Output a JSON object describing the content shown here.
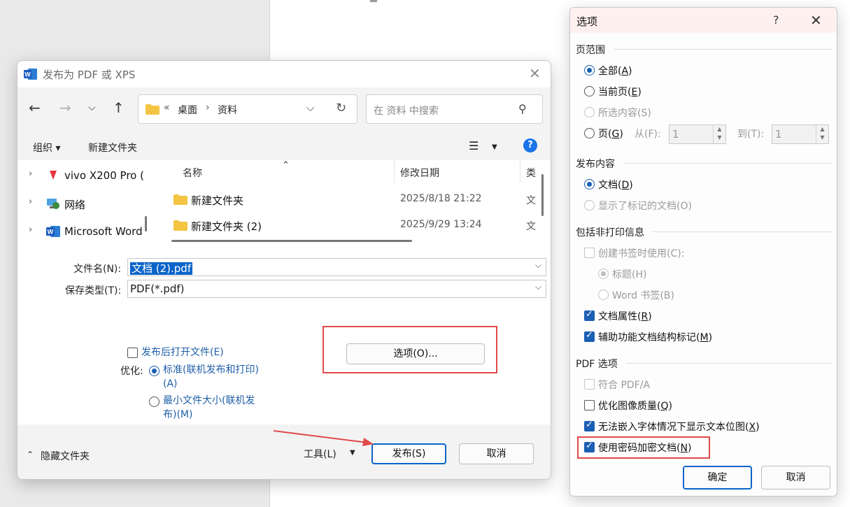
{
  "publish_dialog": {
    "title": "发布为 PDF 或 XPS",
    "address": {
      "chevrons": "«",
      "crumbs": [
        "桌面",
        "资料"
      ]
    },
    "search_placeholder": "在 资料 中搜索",
    "toolbar": {
      "organize": "组织 ▾",
      "new_folder": "新建文件夹",
      "help": "?"
    },
    "tree": [
      {
        "label": "vivo X200 Pro (",
        "icon": "phone-icon"
      },
      {
        "label": "网络",
        "icon": "network-icon"
      },
      {
        "label": "Microsoft Word",
        "icon": "word-icon"
      }
    ],
    "columns": {
      "name": "名称",
      "modified": "修改日期",
      "type": "类"
    },
    "files": [
      {
        "name": "新建文件夹",
        "date": "2025/8/18 21:22",
        "type": "文"
      },
      {
        "name": "新建文件夹 (2)",
        "date": "2025/9/29 13:24",
        "type": "文"
      }
    ],
    "filename_label": "文件名(N):",
    "filename_value": "文档 (2).pdf",
    "filetype_label": "保存类型(T):",
    "filetype_value": "PDF(*.pdf)",
    "open_after": "发布后打开文件(E)",
    "optimize_label": "优化:",
    "opt_standard_1": "标准(联机发布和打印)",
    "opt_standard_2": "(A)",
    "opt_min_1": "最小文件大小(联机发",
    "opt_min_2": "布)(M)",
    "options_button": "选项(O)...",
    "hide_folders": "隐藏文件夹",
    "tools": "工具(L)",
    "publish": "发布(S)",
    "cancel": "取消"
  },
  "options_dialog": {
    "title": "选项",
    "help": "?",
    "range_section": "页范围",
    "all": "全部(",
    "all_key": "A",
    "current": "当前页(",
    "current_key": "E",
    "selection": "所选内容(S)",
    "pages": "页(",
    "pages_key": "G",
    "from_label": "从(F):",
    "from_value": "1",
    "to_label": "到(T):",
    "to_value": "1",
    "content_section": "发布内容",
    "document": "文档(",
    "document_key": "D",
    "markup": "显示了标记的文档(O)",
    "nonprint_section": "包括非打印信息",
    "bookmarks": "创建书签时使用(C):",
    "headings": "标题(H)",
    "word_bookmarks": "Word 书签(B)",
    "doc_props": "文档属性(",
    "doc_props_key": "R",
    "structure_tags": "辅助功能文档结构标记(",
    "structure_tags_key": "M",
    "pdf_section": "PDF 选项",
    "pdfa": "符合 PDF/A",
    "image_quality": "优化图像质量(",
    "image_quality_key": "Q",
    "bitmap_text": "无法嵌入字体情况下显示文本位图(",
    "bitmap_text_key": "X",
    "encrypt": "使用密码加密文档(",
    "encrypt_key": "N",
    "ok": "确定",
    "cancel": "取消"
  },
  "colors": {
    "accent": "#1a5fb4",
    "highlight_box": "#e04a4a",
    "folder": "#f4c542"
  }
}
